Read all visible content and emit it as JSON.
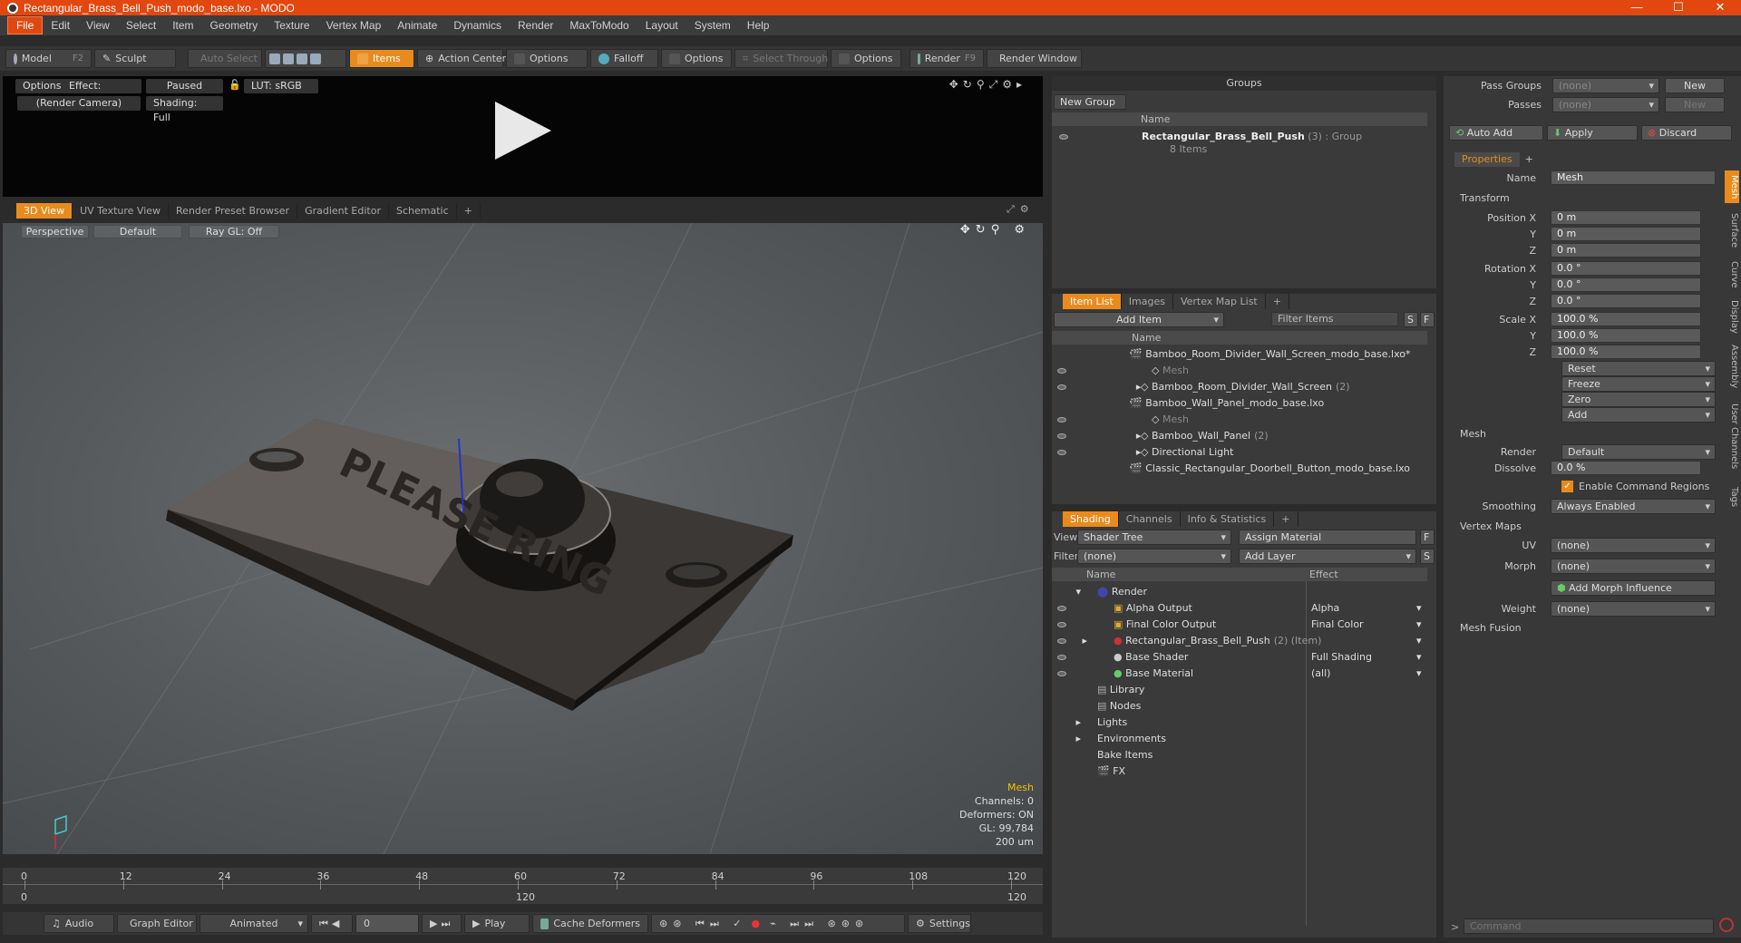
{
  "window": {
    "title": "Rectangular_Brass_Bell_Push_modo_base.lxo - MODO",
    "controls": [
      "—",
      "☐",
      "✕"
    ]
  },
  "menu": [
    "File",
    "Edit",
    "View",
    "Select",
    "Item",
    "Geometry",
    "Texture",
    "Vertex Map",
    "Animate",
    "Dynamics",
    "Render",
    "MaxToModo",
    "Layout",
    "System",
    "Help"
  ],
  "toolbar": {
    "model": "Model",
    "model_key": "F2",
    "sculpt": "Sculpt",
    "auto_select": "Auto Select",
    "items": "Items",
    "action_center": "Action Center",
    "options1": "Options",
    "falloff": "Falloff",
    "options2": "Options",
    "select_through": "Select Through",
    "options3": "Options",
    "render": "Render",
    "render_key": "F9",
    "render_window": "Render Window"
  },
  "preview": {
    "options": "Options",
    "effect": "Effect: (Shadi...",
    "paused": "Paused",
    "lut": "LUT: sRGB",
    "camera": "(Render Camera)",
    "shading": "Shading: Full"
  },
  "viewport_tabs": [
    "3D View",
    "UV Texture View",
    "Render Preset Browser",
    "Gradient Editor",
    "Schematic",
    "+"
  ],
  "viewport": {
    "perspective": "Perspective",
    "default": "Default",
    "raygl": "Ray GL: Off",
    "plate_text": "PLEASE RING",
    "stats": {
      "type": "Mesh",
      "channels": "Channels: 0",
      "deformers": "Deformers: ON",
      "gl": "GL: 99,784",
      "scale": "200 um"
    }
  },
  "timeline": {
    "major": [
      "0",
      "12",
      "24",
      "36",
      "48",
      "60",
      "72",
      "84",
      "96",
      "108",
      "120"
    ],
    "minor": [
      "0",
      "120",
      "120"
    ]
  },
  "bottom": {
    "audio": "Audio",
    "graph_editor": "Graph Editor",
    "animated": "Animated",
    "frame": "0",
    "play": "Play",
    "cache": "Cache Deformers",
    "settings": "Settings"
  },
  "groups": {
    "title": "Groups",
    "new_group": "New Group",
    "col_name": "Name",
    "item_name": "Rectangular_Brass_Bell_Push",
    "item_count": "(3)",
    "item_type": ": Group",
    "item_sub": "8 Items"
  },
  "item_list": {
    "tabs": [
      "Item List",
      "Images",
      "Vertex Map List",
      "+"
    ],
    "add_item": "Add Item",
    "filter": "Filter Items",
    "s": "S",
    "f": "F",
    "col_name": "Name",
    "rows": [
      {
        "label": "Bamboo_Room_Divider_Wall_Screen_modo_base.lxo*",
        "indent": 0,
        "dim": false
      },
      {
        "label": "Mesh",
        "indent": 2,
        "dim": true
      },
      {
        "label": "Bamboo_Room_Divider_Wall_Screen",
        "count": "(2)",
        "indent": 1,
        "dim": false
      },
      {
        "label": "Bamboo_Wall_Panel_modo_base.lxo",
        "indent": 0,
        "dim": false
      },
      {
        "label": "Mesh",
        "indent": 2,
        "dim": true
      },
      {
        "label": "Bamboo_Wall_Panel",
        "count": "(2)",
        "indent": 1,
        "dim": false
      },
      {
        "label": "Directional Light",
        "indent": 1,
        "dim": false
      },
      {
        "label": "Classic_Rectangular_Doorbell_Button_modo_base.lxo",
        "indent": 0,
        "dim": false
      }
    ]
  },
  "shading": {
    "tabs": [
      "Shading",
      "Channels",
      "Info & Statistics",
      "+"
    ],
    "view_label": "View",
    "view_value": "Shader Tree",
    "assign": "Assign Material",
    "f": "F",
    "filter_label": "Filter",
    "filter_value": "(none)",
    "add_layer": "Add Layer",
    "s": "S",
    "col_name": "Name",
    "col_effect": "Effect",
    "rows": [
      {
        "label": "Render",
        "effect": "",
        "indent": 0
      },
      {
        "label": "Alpha Output",
        "effect": "Alpha",
        "indent": 1
      },
      {
        "label": "Final Color Output",
        "effect": "Final Color",
        "indent": 1
      },
      {
        "label": "Rectangular_Brass_Bell_Push",
        "extra": "(2) (Item)",
        "effect": "",
        "indent": 1
      },
      {
        "label": "Base Shader",
        "effect": "Full Shading",
        "indent": 1
      },
      {
        "label": "Base Material",
        "effect": "(all)",
        "indent": 1
      },
      {
        "label": "Library",
        "effect": "",
        "indent": 0
      },
      {
        "label": "Nodes",
        "effect": "",
        "indent": 0
      },
      {
        "label": "Lights",
        "effect": "",
        "indent": 0
      },
      {
        "label": "Environments",
        "effect": "",
        "indent": 0
      },
      {
        "label": "Bake Items",
        "effect": "",
        "indent": 0
      },
      {
        "label": "FX",
        "effect": "",
        "indent": 0
      }
    ]
  },
  "properties": {
    "pass_groups": "Pass Groups",
    "passes": "Passes",
    "none": "(none)",
    "new": "New",
    "auto_add": "Auto Add",
    "apply": "Apply",
    "discard": "Discard",
    "tab": "Properties",
    "plus": "+",
    "name_label": "Name",
    "name_value": "Mesh",
    "transform": "Transform",
    "pos_x_label": "Position X",
    "y": "Y",
    "z": "Z",
    "pos_val": "0 m",
    "rot_x_label": "Rotation X",
    "rot_val": "0.0 °",
    "scale_x_label": "Scale X",
    "scale_val": "100.0 %",
    "reset": "Reset",
    "freeze": "Freeze",
    "zero": "Zero",
    "add": "Add",
    "mesh": "Mesh",
    "render_label": "Render",
    "render_value": "Default",
    "dissolve_label": "Dissolve",
    "dissolve_value": "0.0 %",
    "enable_cmd": "Enable Command Regions",
    "smoothing_label": "Smoothing",
    "smoothing_value": "Always Enabled",
    "vertex_maps": "Vertex Maps",
    "uv_label": "UV",
    "morph_label": "Morph",
    "add_morph": "Add Morph Influence",
    "weight_label": "Weight",
    "mesh_fusion": "Mesh Fusion",
    "side_tabs": [
      "Mesh",
      "Surface",
      "Curve",
      "Display",
      "Assembly",
      "User Channels",
      "Tags"
    ],
    "command_placeholder": "Command"
  }
}
